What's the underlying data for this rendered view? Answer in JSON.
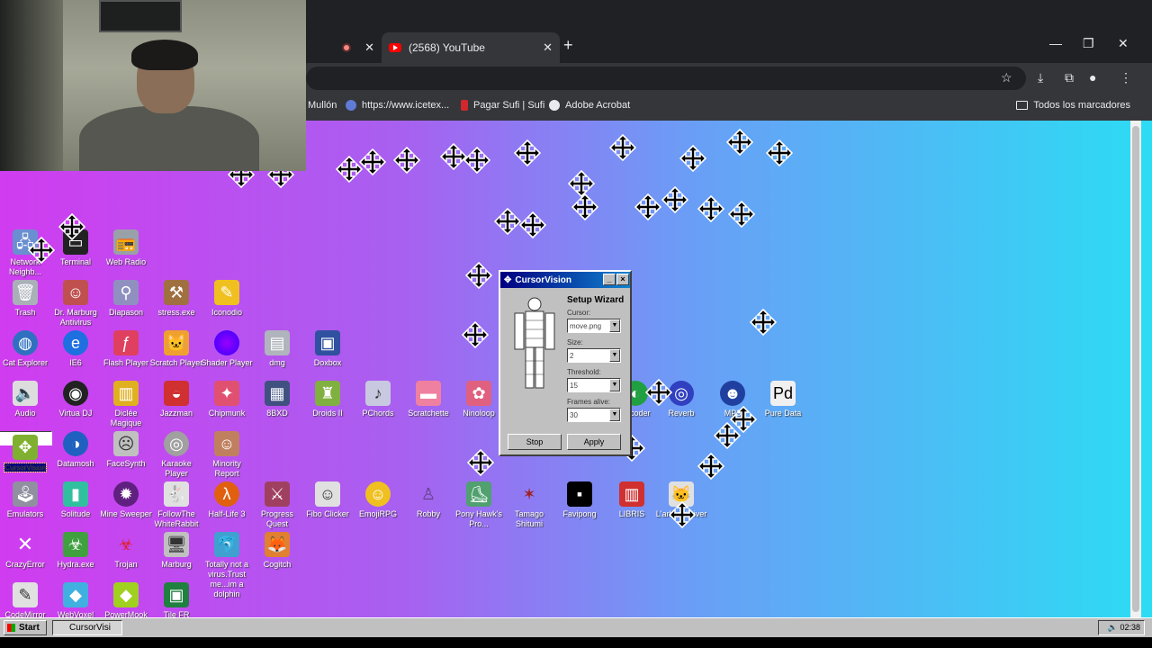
{
  "browser": {
    "tabs": [
      {
        "label": "",
        "recording": true
      },
      {
        "label": "(2568) YouTube",
        "active": true
      }
    ],
    "new_tab": "+",
    "window_controls": {
      "minimize": "—",
      "restore": "❐",
      "close": "✕"
    },
    "bookmarks": [
      {
        "label": "Mullón"
      },
      {
        "label": "https://www.icetex..."
      },
      {
        "label": "Pagar Sufi | Sufi"
      },
      {
        "label": "Adobe Acrobat"
      }
    ],
    "all_bookmarks": "Todos los marcadores"
  },
  "desktop": {
    "icons": [
      {
        "label": "Network Neighb..."
      },
      {
        "label": "Terminal"
      },
      {
        "label": "Web Radio"
      },
      {
        "label": "Trash"
      },
      {
        "label": "Dr. Marburg Antivirus"
      },
      {
        "label": "Diapason"
      },
      {
        "label": "stress.exe"
      },
      {
        "label": "Iconodio"
      },
      {
        "label": "Cat Explorer"
      },
      {
        "label": "IE6"
      },
      {
        "label": "Flash Player"
      },
      {
        "label": "Scratch Player"
      },
      {
        "label": "Shader Player"
      },
      {
        "label": "dmg"
      },
      {
        "label": "Doxbox"
      },
      {
        "label": "Audio"
      },
      {
        "label": "Virtua DJ"
      },
      {
        "label": "Diclée Magique"
      },
      {
        "label": "Jazzman"
      },
      {
        "label": "Chipmunk"
      },
      {
        "label": "8BXD"
      },
      {
        "label": "Droids II"
      },
      {
        "label": "PChords"
      },
      {
        "label": "Scratchette"
      },
      {
        "label": "Ninoloop"
      },
      {
        "label": "Vocoder"
      },
      {
        "label": "Reverb"
      },
      {
        "label": "MP3"
      },
      {
        "label": "Pure Data"
      },
      {
        "label": "CursorVision"
      },
      {
        "label": "Datamosh"
      },
      {
        "label": "FaceSynth"
      },
      {
        "label": "Karaoke Player"
      },
      {
        "label": "Minority Report"
      },
      {
        "label": "Emulators"
      },
      {
        "label": "Solitude"
      },
      {
        "label": "Mine Sweeper"
      },
      {
        "label": "FollowThe WhiteRabbit"
      },
      {
        "label": "Half-Life 3"
      },
      {
        "label": "Progress Quest"
      },
      {
        "label": "Fibo Clicker"
      },
      {
        "label": "EmojiRPG"
      },
      {
        "label": "Robby"
      },
      {
        "label": "Pony Hawk's Pro..."
      },
      {
        "label": "Tamago Shitumi"
      },
      {
        "label": "Favipong"
      },
      {
        "label": "LIBRIS"
      },
      {
        "label": "L'arbre d'hiver"
      },
      {
        "label": "CrazyError"
      },
      {
        "label": "Hydra.exe"
      },
      {
        "label": "Trojan"
      },
      {
        "label": "Marburg"
      },
      {
        "label": "Totally not a virus.Trust me...im a dolphin"
      },
      {
        "label": "Cogitch"
      },
      {
        "label": "CodeMirror"
      },
      {
        "label": "WebVoxel"
      },
      {
        "label": "PowerMook"
      },
      {
        "label": "Tile FR"
      }
    ]
  },
  "dialog": {
    "title": "CursorVision",
    "heading": "Setup Wizard",
    "fields": [
      {
        "label": "Cursor:",
        "value": "move.png"
      },
      {
        "label": "Size:",
        "value": "2"
      },
      {
        "label": "Threshold:",
        "value": "15"
      },
      {
        "label": "Frames alive:",
        "value": "30"
      }
    ],
    "stop_label": "Stop",
    "apply_label": "Apply",
    "minimize": "_",
    "close": "×"
  },
  "taskbar": {
    "start_label": "Start",
    "task_label": "CursorVisi",
    "clock": "02:38"
  }
}
